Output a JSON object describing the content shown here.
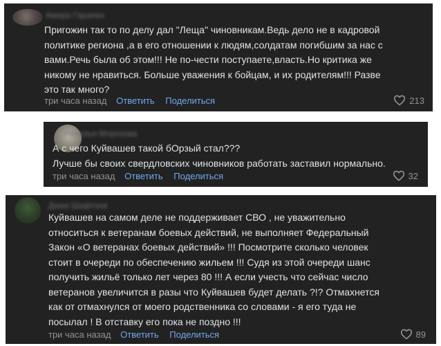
{
  "comments": [
    {
      "author": "Амира Гараева",
      "text": "Пригожин так то по делу дал \"Леща\" чиновникам.Ведь дело не в кадровой\nполитике региона ,а в его отношении к людям,солдатам погибшим за нас с\nвами.Речь была об этом!!! Не по-чести поступаете,власть.Но критика же\nникому не нравиться. Больше уважения к бойцам, и их родителям!!! Разве\nэто так много?",
      "time": "три часа назад",
      "reply_label": "Ответить",
      "share_label": "Поделиться",
      "likes": "213"
    },
    {
      "author": "Наталья Морозова",
      "text": "А с чего Куйвашев такой бОрзый стал???\nЛучше бы своих свердловских чиновников работать заставил нормально.",
      "time": "три часа назад",
      "reply_label": "Ответить",
      "share_label": "Поделиться",
      "likes": "32"
    },
    {
      "author": "Дима Шафтоев",
      "text": "Куйвашев на самом деле не поддерживает СВО , не уважительно\nотноситься к ветеранам боевых действий, не выполняет Федеральный\nЗакон «О ветеранах боевых действий» !!! Посмотрите сколько человек\nстоит в очереди по обеспечению жильем !!! Судя из этой очереди шанс\nполучить жильё только лет через 80 !!! А если учесть что сейчас число\nветеранов увеличится в разы что Куйвашев будет делать ?!? Отмахнется\nкак от отмахнулся от моего родственника со словами - я его туда не\nпосылал ! В отставку его пока не поздно !!!",
      "time": "три часа назад",
      "reply_label": "Ответить",
      "share_label": "Поделиться",
      "likes": "89"
    }
  ],
  "colors": {
    "card_bg": "#222222",
    "text": "#e1e3e6",
    "secondary": "#909499",
    "accent": "#71aaeb"
  },
  "icons": {
    "like": "heart-outline-icon"
  }
}
